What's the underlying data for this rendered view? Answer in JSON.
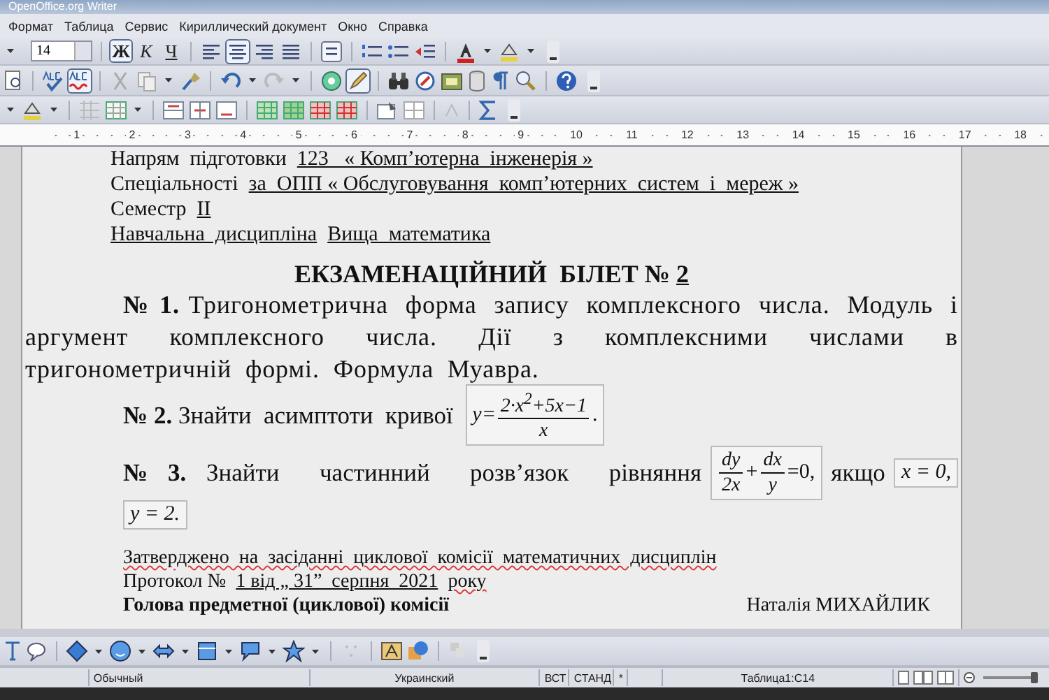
{
  "window": {
    "title": "OpenOffice.org Writer"
  },
  "menu": [
    "Формат",
    "Таблица",
    "Сервис",
    "Кириллический документ",
    "Окно",
    "Справка"
  ],
  "formatting_toolbar": {
    "font_size": "14",
    "style_buttons": [
      {
        "label": "Ж",
        "selected": true
      },
      {
        "label": "К",
        "selected": false
      },
      {
        "label": "Ч",
        "selected": false
      }
    ],
    "align_buttons": [
      {
        "selected": false
      },
      {
        "selected": true
      },
      {
        "selected": false
      },
      {
        "selected": false
      }
    ]
  },
  "standard_toolbar": {
    "autospellcheck_on": true,
    "draw_functions_on": true
  },
  "ruler": {
    "marks": [
      "1",
      "2",
      "3",
      "4",
      "5",
      "6",
      "7",
      "8",
      "9",
      "10",
      "11",
      "12",
      "13",
      "14",
      "15",
      "16",
      "17",
      "18"
    ]
  },
  "document": {
    "header_lines": [
      {
        "label": "Напрям  підготовки",
        "value": "123   « Комп’ютерна  інженерія »",
        "label_underlined": false
      },
      {
        "label": "Спеціальності",
        "value": "за  ОПП « Обслуговування  комп’ютерних  систем  і  мереж »",
        "label_underlined": false
      },
      {
        "label": "Семестр",
        "value": "II",
        "label_underlined": false
      },
      {
        "label": "Навчальна  дисципліна",
        "value": "Вища  математика",
        "label_underlined": true
      }
    ],
    "title": "ЕКЗАМЕНАЦІЙНИЙ  БІЛЕТ №",
    "title_number": "2",
    "task_1": "**№ 1.** Тригонометрична  форма  запису  комплексного  числа.  Модуль  і  аргумент  комплексного  числа.  Дії  з  комплексними  числами  в  тригонометричній  формі.  Формула  Муавра.",
    "task_2": {
      "text": "**№ 2.** Знайти  асимптоти  кривої",
      "formula": {
        "lhs": "y",
        "equals": "=",
        "numerator": "2·x$^{2}$+5x−1",
        "denominator": "x",
        "end": "."
      }
    },
    "task_3": {
      "text": "**№ 3.** Знайти  частинний  розв’язок  рівняння",
      "formula": {
        "terms": [
          {
            "numerator": "dy",
            "denominator": "2x"
          },
          {
            "numerator": "dx",
            "denominator": "y"
          }
        ],
        "plus": "+",
        "rhs": "=0,"
      },
      "condition_word": "якщо",
      "condition_1": "x = 0,",
      "condition_2": "y = 2."
    },
    "footer_lines": [
      "Затверджено  на  засіданні  циклової  комісії  математичних  дисциплін"
    ],
    "protocol": {
      "label": "Протокол №",
      "value": "1 від „ 31”  серпня  2021",
      "suffix": "року"
    },
    "signature": {
      "role": "Голова предметної (циклової) комісії",
      "name": "Наталія МИХАЙЛИК"
    }
  },
  "status_bar": {
    "style": "Обычный",
    "language": "Украинский",
    "insert_mode": "ВСТ",
    "selection_mode": "СТАНД",
    "modified": "*",
    "position": "Таблица1:C14",
    "zoom_slider": {
      "level": 0.95
    }
  }
}
